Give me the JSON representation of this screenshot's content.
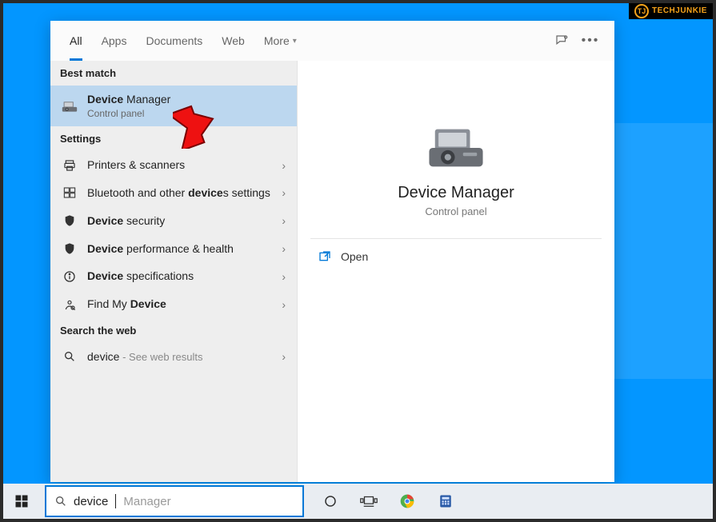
{
  "watermark": "TECHJUNKIE",
  "tabs": {
    "all": "All",
    "apps": "Apps",
    "documents": "Documents",
    "web": "Web",
    "more": "More"
  },
  "sections": {
    "best_match": "Best match",
    "settings": "Settings",
    "search_web": "Search the web"
  },
  "best_match": {
    "title_prefix": "Device",
    "title_rest": " Manager",
    "subtitle": "Control panel",
    "icon": "device-manager-icon"
  },
  "settings_items": [
    {
      "label": "Printers & scanners",
      "icon": "printer-icon"
    },
    {
      "label_html": "Bluetooth and other <strong class='b'>device</strong>s settings",
      "icon": "bluetooth-settings-icon"
    },
    {
      "label_html": "<strong class='b'>Device</strong> security",
      "icon": "shield-icon"
    },
    {
      "label_html": "<strong class='b'>Device</strong> performance & health",
      "icon": "shield-icon"
    },
    {
      "label_html": "<strong class='b'>Device</strong> specifications",
      "icon": "info-icon"
    },
    {
      "label_html": "Find My <strong class='b'>Device</strong>",
      "icon": "find-device-icon"
    }
  ],
  "web_item": {
    "prefix": "device",
    "suffix": " - See web results",
    "icon": "search-icon"
  },
  "preview": {
    "title": "Device Manager",
    "subtitle": "Control panel",
    "open_label": "Open"
  },
  "search": {
    "typed": "device",
    "suggestion_suffix": " Manager"
  },
  "taskbar_icons": [
    "start-icon",
    "cortana-icon",
    "task-view-icon",
    "chrome-icon",
    "calculator-icon"
  ]
}
